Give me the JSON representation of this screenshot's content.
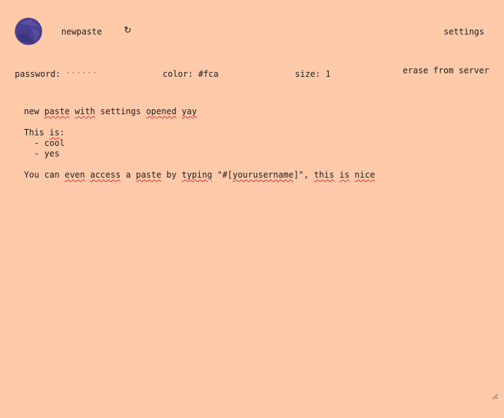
{
  "header": {
    "avatar_icon": "circle-logo-icon",
    "newpaste_label": "newpaste",
    "refresh_icon": "↻",
    "settings_label": "settings"
  },
  "options": {
    "password_label": "password:",
    "password_value": "······",
    "color_label": "color:",
    "color_value": "#fca",
    "size_label": "size:",
    "size_value": "1",
    "erase_label": "erase from server"
  },
  "paste": {
    "lines": [
      "new paste with settings opened yay",
      "",
      "This is:",
      "  - cool",
      "  - yes",
      "",
      "You can even access a paste by typing \"#[yourusername]\", this is nice"
    ]
  },
  "colors": {
    "background": "#ffcaaa",
    "avatar": "#4a3f8f",
    "text": "#1c1c1c",
    "spellcheck": "#e03030"
  }
}
